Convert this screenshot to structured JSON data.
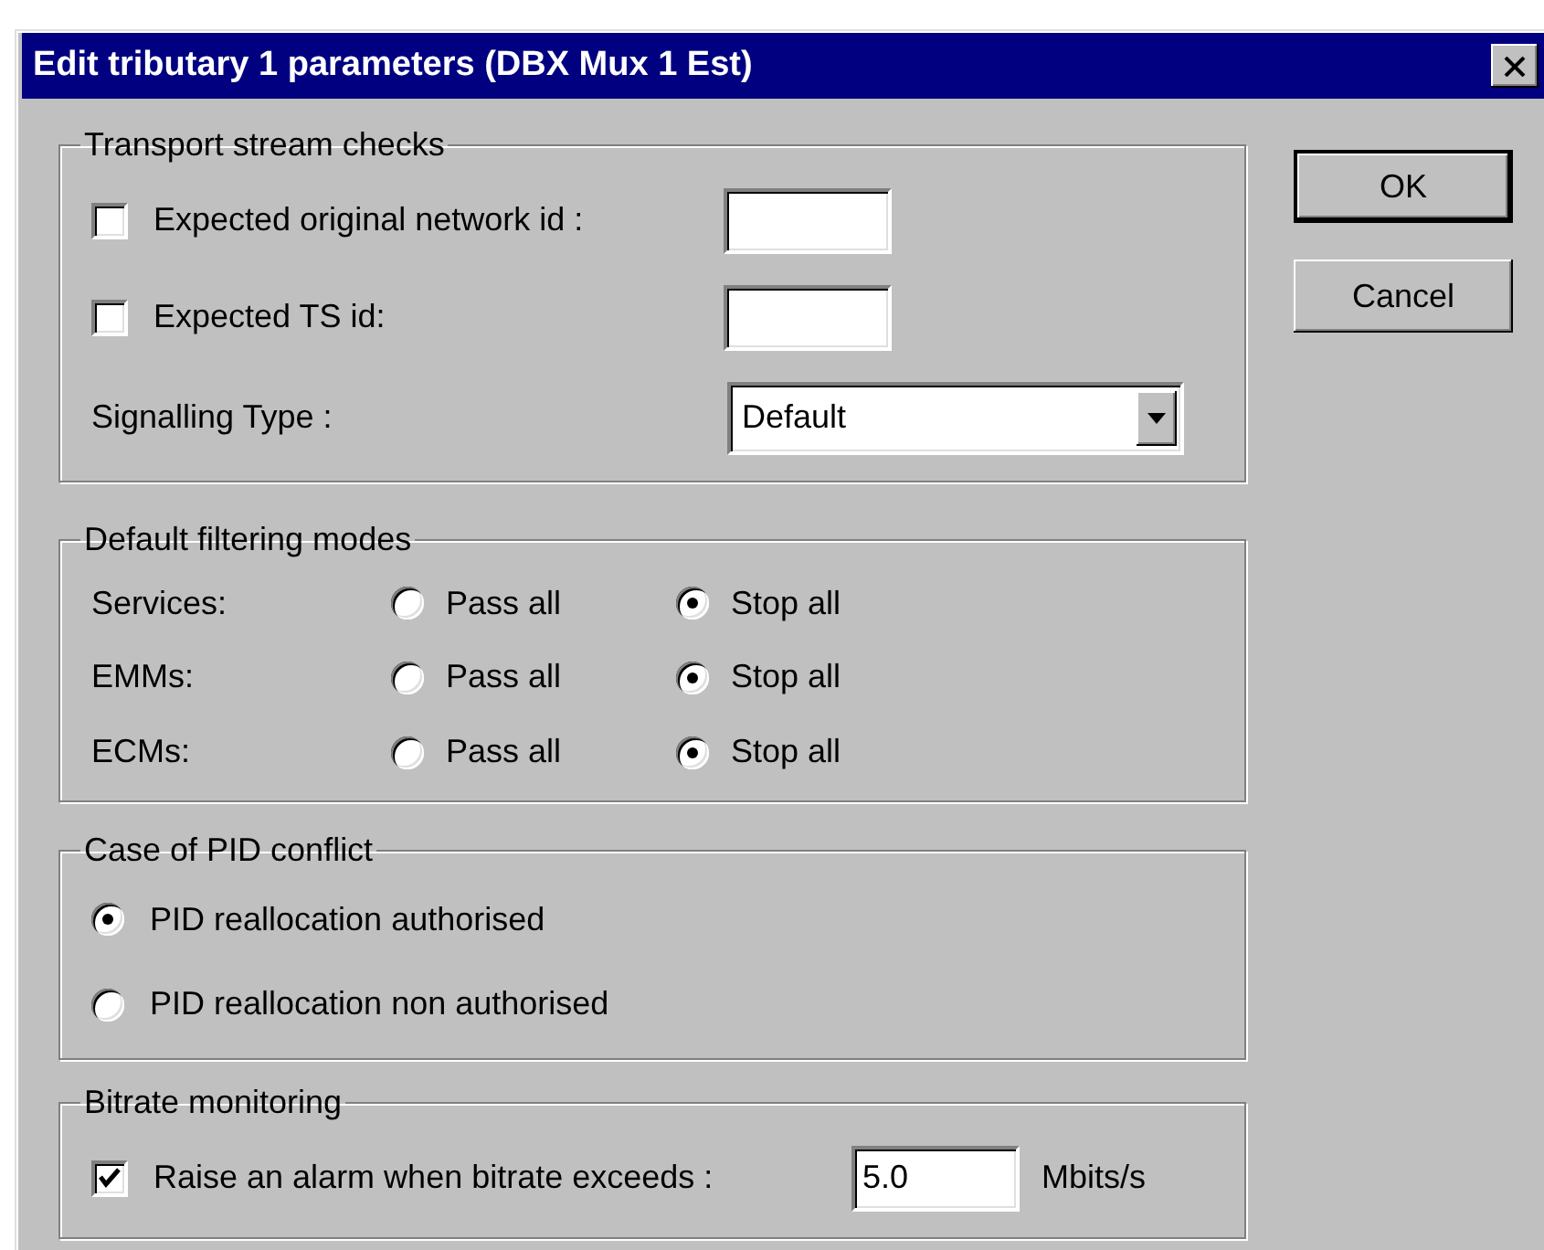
{
  "window": {
    "title": "Edit tributary 1 parameters (DBX Mux 1 Est)"
  },
  "transport_checks": {
    "title": "Transport stream checks",
    "checks": [
      {
        "label": "Expected original network id :",
        "checked": false
      },
      {
        "label": "Expected TS id:",
        "checked": false
      }
    ],
    "signalling": {
      "label": "Signalling Type :",
      "value": "Default"
    }
  },
  "filtering": {
    "title": "Default filtering modes",
    "rows": [
      {
        "label": "Services:",
        "options": [
          {
            "label": "Pass all",
            "selected": false
          },
          {
            "label": "Stop all",
            "selected": true
          }
        ]
      },
      {
        "label": "EMMs:",
        "options": [
          {
            "label": "Pass all",
            "selected": false
          },
          {
            "label": "Stop all",
            "selected": true
          }
        ]
      },
      {
        "label": "ECMs:",
        "options": [
          {
            "label": "Pass all",
            "selected": false
          },
          {
            "label": "Stop all",
            "selected": true
          }
        ]
      }
    ]
  },
  "pid_conflict": {
    "title": "Case of PID conflict",
    "options": [
      {
        "label": "PID reallocation authorised",
        "selected": true
      },
      {
        "label": "PID reallocation non authorised",
        "selected": false
      }
    ]
  },
  "bitrate": {
    "title": "Bitrate monitoring",
    "checked": true,
    "label": "Raise an alarm when bitrate exceeds :",
    "value": "5.0",
    "unit": "Mbits/s"
  },
  "buttons": [
    {
      "label": "OK",
      "default": true
    },
    {
      "label": "Cancel",
      "default": false
    }
  ]
}
